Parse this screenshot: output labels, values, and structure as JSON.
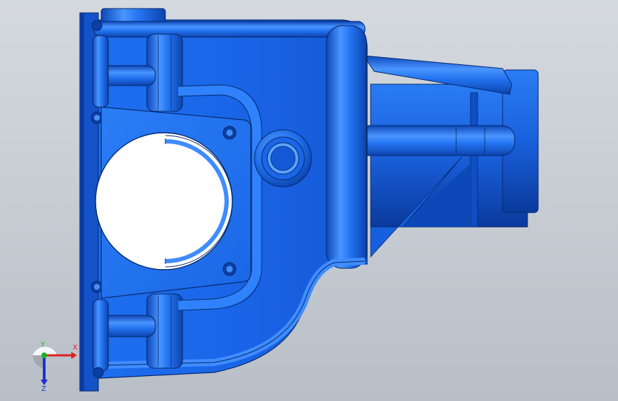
{
  "viewport": {
    "colors": {
      "bg_top": "#d4d9df",
      "bg_bottom": "#b9bfc7",
      "part_base": "#1565e6",
      "part_light": "#3f8cff",
      "part_dark": "#0b3fa6",
      "edge": "#062a6e"
    }
  },
  "triad": {
    "x_label": "X",
    "y_label": "Y",
    "z_label": "Z",
    "x_color": "#e02020",
    "y_color": "#20b020",
    "z_color": "#2030d0"
  }
}
